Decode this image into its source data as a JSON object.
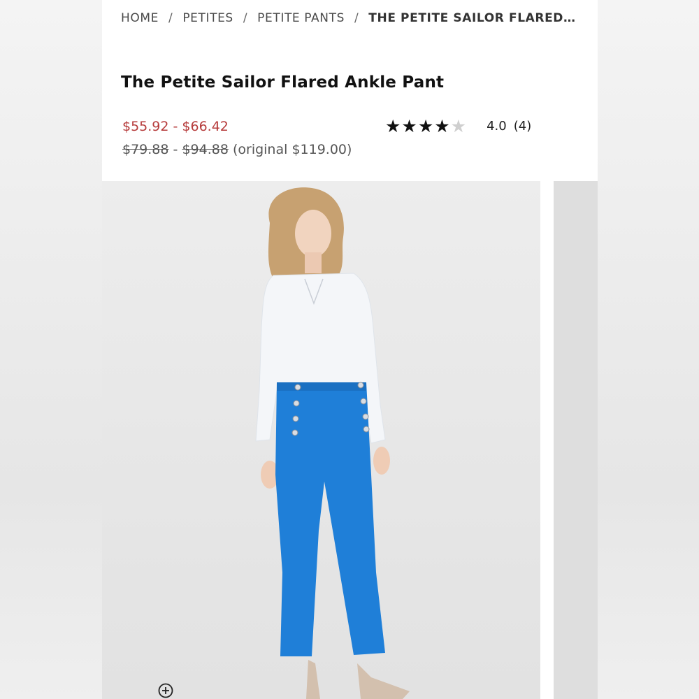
{
  "breadcrumb": {
    "items": [
      "HOME",
      "PETITES",
      "PETITE PANTS"
    ],
    "current": "THE PETITE SAILOR FLARED AN...",
    "separator": "/"
  },
  "product": {
    "title": "The Petite Sailor Flared Ankle Pant",
    "sale_price": "$55.92 - $66.42",
    "was_low": "$79.88",
    "was_dash": "-",
    "was_high": "$94.88",
    "original": "(original $119.00)"
  },
  "rating": {
    "stars_filled": "★★★★",
    "stars_empty": "★",
    "value": "4.0",
    "count": "(4)",
    "score": 4.0,
    "max": 5
  },
  "colors": {
    "sale_price": "#b63b3b",
    "pant_blue": "#1f7fd8"
  },
  "icons": {
    "zoom": "zoom-in-icon"
  }
}
